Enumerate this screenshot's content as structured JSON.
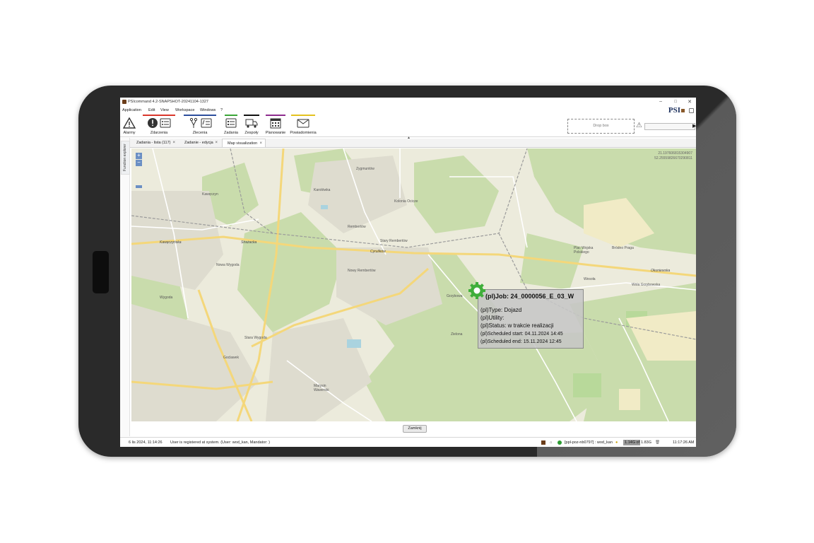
{
  "window": {
    "title": "PSIcommand 4.2-SNAPSHOT-20241104-1327",
    "minimize": "–",
    "maximize": "□",
    "close": "✕"
  },
  "menu": [
    "Application",
    "Edit",
    "View",
    "Workspace",
    "Windows",
    "?"
  ],
  "logo_text": "PSI",
  "toolbar": {
    "items": [
      {
        "label": "Alarmy",
        "color": "#ffffff"
      },
      {
        "label": "Zdarzenia",
        "color": "#d9362b"
      },
      {
        "label": "Zlecenia",
        "color": "#2c4e9c"
      },
      {
        "label": "Zadania",
        "color": "#3aa537"
      },
      {
        "label": "Zespoły",
        "color": "#111111"
      },
      {
        "label": "Planowanie",
        "color": "#8e2c8e"
      },
      {
        "label": "Powiadomienia",
        "color": "#e3c21f"
      }
    ],
    "drop_box": "Drop box"
  },
  "side_panel_label": "Function explorer",
  "tabs": [
    {
      "label": "Zadania - lista (117)"
    },
    {
      "label": "Zadanie - edycja"
    },
    {
      "label": "Map visualization"
    }
  ],
  "map": {
    "zoom_in": "+",
    "zoom_out": "−",
    "coords_line1": "21.197606815304907",
    "coords_line2": "52.25559826670290811",
    "place_labels": [
      "Karolówka",
      "Rembertów",
      "Stary Rembertów",
      "Nowy Rembertów",
      "Kawęczyn",
      "Nowa Wygoda",
      "Wygoda",
      "Stara Wygoda",
      "Goclawek",
      "Marysin Wawerski",
      "Grzybowa",
      "Wesoła",
      "Wola Grzybowska",
      "Zielona",
      "Kolonia Ocicze",
      "Zygmuntów",
      "Plac Wojska Polskiego",
      "Bródno Praga"
    ],
    "street_labels": [
      "Cyrulików",
      "Okuniewska",
      "Strażacka",
      "Kawęczyńska"
    ]
  },
  "tooltip": {
    "job": "(pl)Job: 24_0000056_E_03_W",
    "type": "(pl)Type: Dojazd",
    "utility": "(pl)Utility:",
    "status": "(pl)Status:  w trakcie realizacji",
    "scheduled_start": "(pl)Scheduled start: 04.11.2024 14:45",
    "scheduled_end": "(pl)Scheduled end: 15.11.2024 12:45"
  },
  "close_button": "Zamknij",
  "status": {
    "datetime": "6 lis 2024, 11:14:26",
    "message": "User is registered at system. (User: wod_kan, Mandator: )",
    "session": "[ppl-poz-nb0797] : wod_kan",
    "mem_used": "1.14G of",
    "mem_total": "1.83G",
    "clock": "11:17:26 AM"
  }
}
